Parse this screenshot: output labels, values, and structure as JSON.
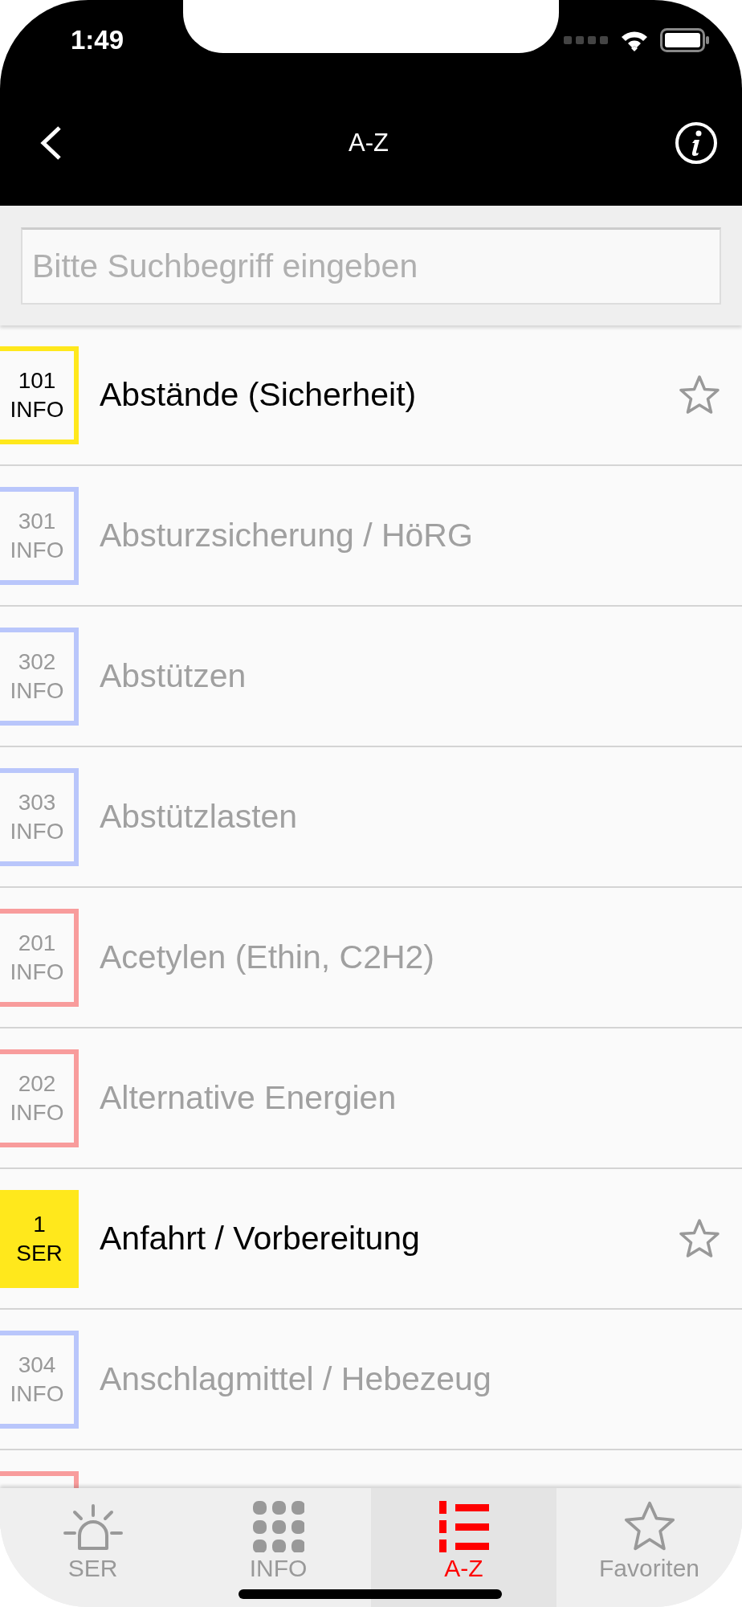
{
  "status_bar": {
    "time": "1:49"
  },
  "nav": {
    "title": "A-Z"
  },
  "search": {
    "placeholder": "Bitte Suchbegriff eingeben"
  },
  "items": [
    {
      "number": "101",
      "category": "INFO",
      "title": "Abstände (Sicherheit)",
      "kind": "outline",
      "color": "#ffe81c",
      "active": true
    },
    {
      "number": "301",
      "category": "INFO",
      "title": "Absturzsicherung / HöRG",
      "kind": "outline",
      "color": "#b9c6fb",
      "active": false
    },
    {
      "number": "302",
      "category": "INFO",
      "title": "Abstützen",
      "kind": "outline",
      "color": "#b9c6fb",
      "active": false
    },
    {
      "number": "303",
      "category": "INFO",
      "title": "Abstützlasten",
      "kind": "outline",
      "color": "#b9c6fb",
      "active": false
    },
    {
      "number": "201",
      "category": "INFO",
      "title": "Acetylen (Ethin, C2H2)",
      "kind": "outline",
      "color": "#f89c9c",
      "active": false
    },
    {
      "number": "202",
      "category": "INFO",
      "title": "Alternative Energien",
      "kind": "outline",
      "color": "#f89c9c",
      "active": false
    },
    {
      "number": "1",
      "category": "SER",
      "title": "Anfahrt / Vorbereitung",
      "kind": "filled",
      "color": "#ffe81c",
      "active": true
    },
    {
      "number": "304",
      "category": "INFO",
      "title": "Anschlagmittel / Hebezeug",
      "kind": "outline",
      "color": "#b9c6fb",
      "active": false
    },
    {
      "kind": "outline",
      "color": "#f89c9c"
    }
  ],
  "tabs": [
    {
      "label": "SER",
      "kind": "siren",
      "selected": false
    },
    {
      "label": "INFO",
      "kind": "grid",
      "selected": false
    },
    {
      "label": "A-Z",
      "kind": "list",
      "selected": true
    },
    {
      "label": "Favoriten",
      "kind": "star",
      "selected": false
    }
  ]
}
